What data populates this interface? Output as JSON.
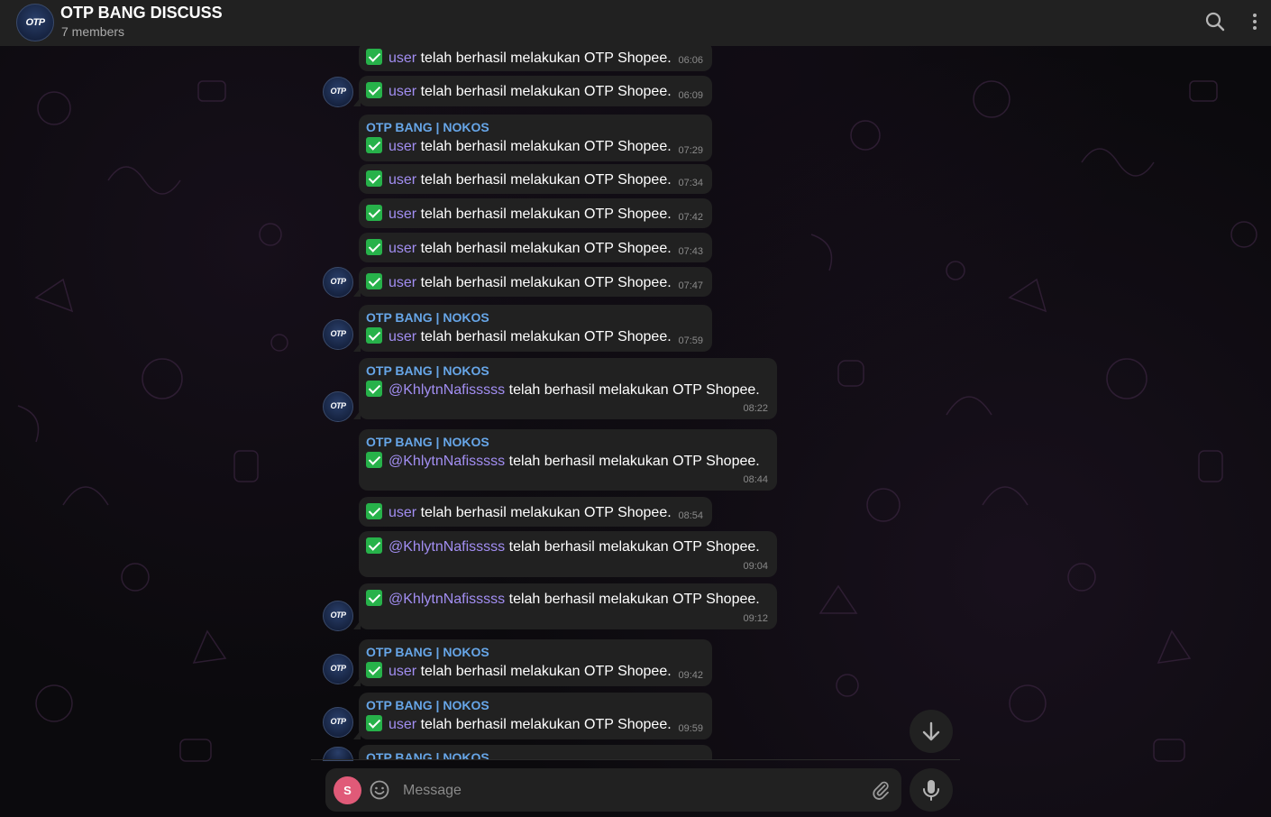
{
  "header": {
    "title": "OTP BANG DISCUSS",
    "subtitle": "7 members",
    "avatar_text": "OTP"
  },
  "messages": [
    {
      "sender": "",
      "mention": "user",
      "text": "telah berhasil melakukan OTP Shopee.",
      "time": "06:06"
    },
    {
      "sender": "",
      "mention": "user",
      "text": "telah berhasil melakukan OTP Shopee.",
      "time": "06:09"
    },
    {
      "sender": "OTP BANG | NOKOS",
      "mention": "user",
      "text": "telah berhasil melakukan OTP Shopee.",
      "time": "07:29"
    },
    {
      "sender": "",
      "mention": "user",
      "text": "telah berhasil melakukan OTP Shopee.",
      "time": "07:34"
    },
    {
      "sender": "",
      "mention": "user",
      "text": "telah berhasil melakukan OTP Shopee.",
      "time": "07:42"
    },
    {
      "sender": "",
      "mention": "user",
      "text": "telah berhasil melakukan OTP Shopee.",
      "time": "07:43"
    },
    {
      "sender": "",
      "mention": "user",
      "text": "telah berhasil melakukan OTP Shopee.",
      "time": "07:47"
    },
    {
      "sender": "OTP BANG | NOKOS",
      "mention": "user",
      "text": "telah berhasil melakukan OTP Shopee.",
      "time": "07:59"
    },
    {
      "sender": "OTP BANG | NOKOS",
      "mention": "@KhlytnNafisssss",
      "text": "telah berhasil melakukan OTP Shopee.",
      "time": "08:22"
    },
    {
      "sender": "OTP BANG | NOKOS",
      "mention": "@KhlytnNafisssss",
      "text": "telah berhasil melakukan OTP Shopee.",
      "time": "08:44"
    },
    {
      "sender": "",
      "mention": "user",
      "text": "telah berhasil melakukan OTP Shopee.",
      "time": "08:54"
    },
    {
      "sender": "",
      "mention": "@KhlytnNafisssss",
      "text": "telah berhasil melakukan OTP Shopee.",
      "time": "09:04"
    },
    {
      "sender": "",
      "mention": "@KhlytnNafisssss",
      "text": "telah berhasil melakukan OTP Shopee.",
      "time": "09:12"
    },
    {
      "sender": "OTP BANG | NOKOS",
      "mention": "user",
      "text": "telah berhasil melakukan OTP Shopee.",
      "time": "09:42"
    },
    {
      "sender": "OTP BANG | NOKOS",
      "mention": "user",
      "text": "telah berhasil melakukan OTP Shopee.",
      "time": "09:59"
    },
    {
      "sender": "OTP BANG | NOKOS",
      "mention": "",
      "text": "",
      "time": ""
    }
  ],
  "composer": {
    "user_initial": "S",
    "placeholder": "Message"
  },
  "icons": {
    "search": "search-icon",
    "more": "more-vertical-icon",
    "emoji": "emoji-icon",
    "attach": "paperclip-icon",
    "mic": "microphone-icon",
    "scroll_down": "arrow-down-icon",
    "check": "check-mark-icon"
  },
  "colors": {
    "header_bg": "#212121",
    "bubble_bg": "#212121",
    "sender_name": "#67a6e8",
    "mention": "#a28ef2",
    "check": "#27b24a",
    "user_avatar": "#e05a78"
  }
}
